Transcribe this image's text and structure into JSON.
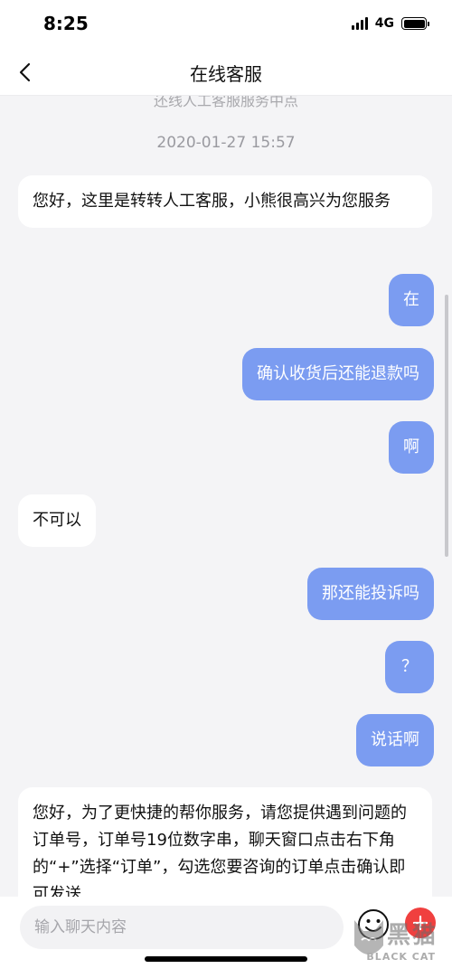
{
  "status_bar": {
    "time": "8:25",
    "network": "4G"
  },
  "header": {
    "title": "在线客服",
    "back_icon": "chevron-left-icon"
  },
  "chat": {
    "system_note": "还线人工客服服务中点",
    "timestamp": "2020-01-27 15:57",
    "messages": [
      {
        "side": "left",
        "text": "您好，这里是转转人工客服，小熊很高兴为您服务"
      },
      {
        "side": "right",
        "text": "在"
      },
      {
        "side": "right",
        "text": "确认收货后还能退款吗"
      },
      {
        "side": "right",
        "text": "啊"
      },
      {
        "side": "left",
        "text": "不可以"
      },
      {
        "side": "right",
        "text": "那还能投诉吗"
      },
      {
        "side": "right",
        "text": "？"
      },
      {
        "side": "right",
        "text": "说话啊"
      },
      {
        "side": "left",
        "text": "您好，为了更快捷的帮你服务，请您提供遇到问题的订单号，订单号19位数字串，聊天窗口点击右下角的“+”选择“订单”，勾选您要咨询的订单点击确认即可发送"
      }
    ]
  },
  "input_bar": {
    "placeholder": "输入聊天内容",
    "emoji_icon": "smiley-face-icon",
    "add_icon": "plus-icon"
  },
  "watermark": {
    "text": "黑猫",
    "sub": "BLACK CAT"
  },
  "colors": {
    "outgoing_bubble": "#7b9cf1",
    "incoming_bubble": "#ffffff",
    "add_button": "#f0403f",
    "background": "#f4f4f6"
  }
}
